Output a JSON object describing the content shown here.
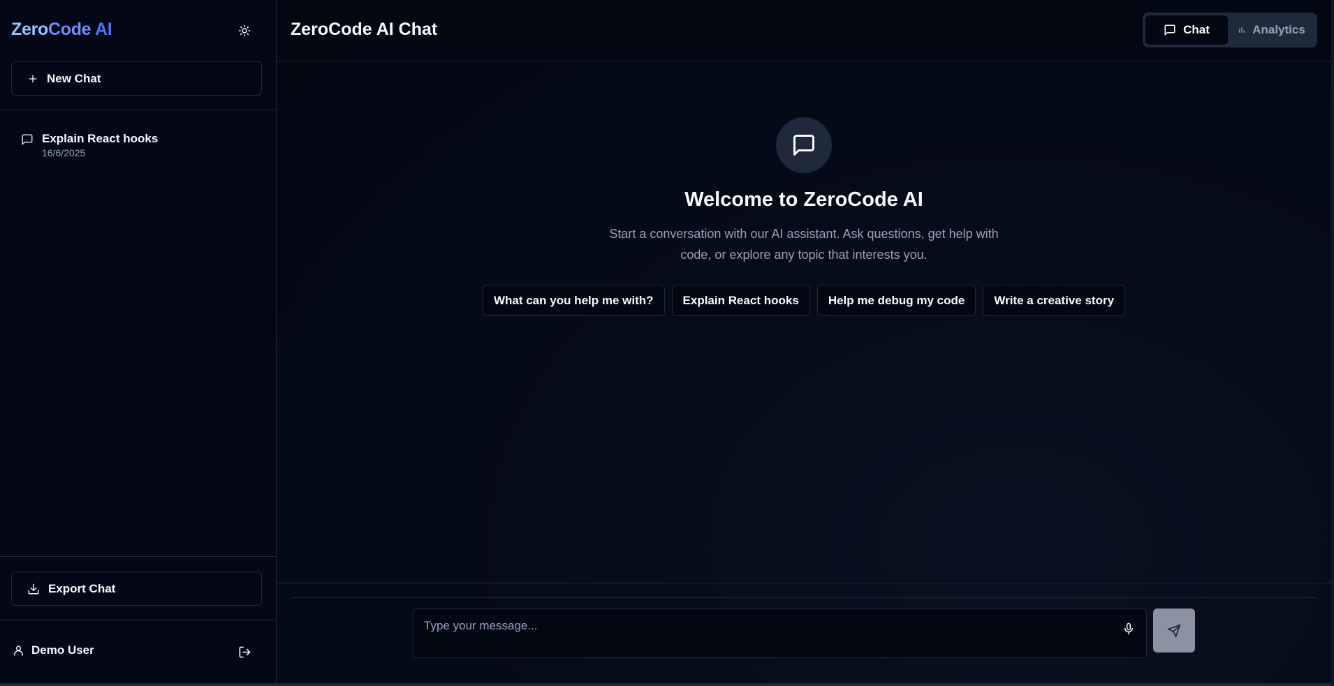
{
  "sidebar": {
    "brand": {
      "part1": "Zero",
      "part2": "Code ",
      "part3": "AI"
    },
    "theme_toggle_icon": "sun-icon",
    "new_chat_label": "New Chat",
    "history": [
      {
        "title": "Explain React hooks",
        "date": "16/6/2025",
        "icon": "message-square-icon"
      }
    ],
    "export_label": "Export Chat",
    "user_name": "Demo User",
    "logout_icon": "logout-icon"
  },
  "header": {
    "title": "ZeroCode AI Chat",
    "tabs": [
      {
        "label": "Chat",
        "icon": "message-square-icon",
        "active": true
      },
      {
        "label": "Analytics",
        "icon": "bar-chart-icon",
        "active": false
      }
    ]
  },
  "welcome": {
    "title": "Welcome to ZeroCode AI",
    "subtitle": "Start a conversation with our AI assistant. Ask questions, get help with code, or explore any topic that interests you.",
    "suggestions": [
      "What can you help me with?",
      "Explain React hooks",
      "Help me debug my code",
      "Write a creative story"
    ]
  },
  "composer": {
    "placeholder": "Type your message...",
    "mic_icon": "mic-icon",
    "send_icon": "send-icon"
  },
  "colors": {
    "background": "#030712",
    "border": "#1e293b",
    "text": "#f8fafc",
    "muted": "#94a3b8",
    "brand_light": "#93c5fd",
    "brand_dark": "#4f74f2",
    "send_disabled": "#8a93a1"
  }
}
